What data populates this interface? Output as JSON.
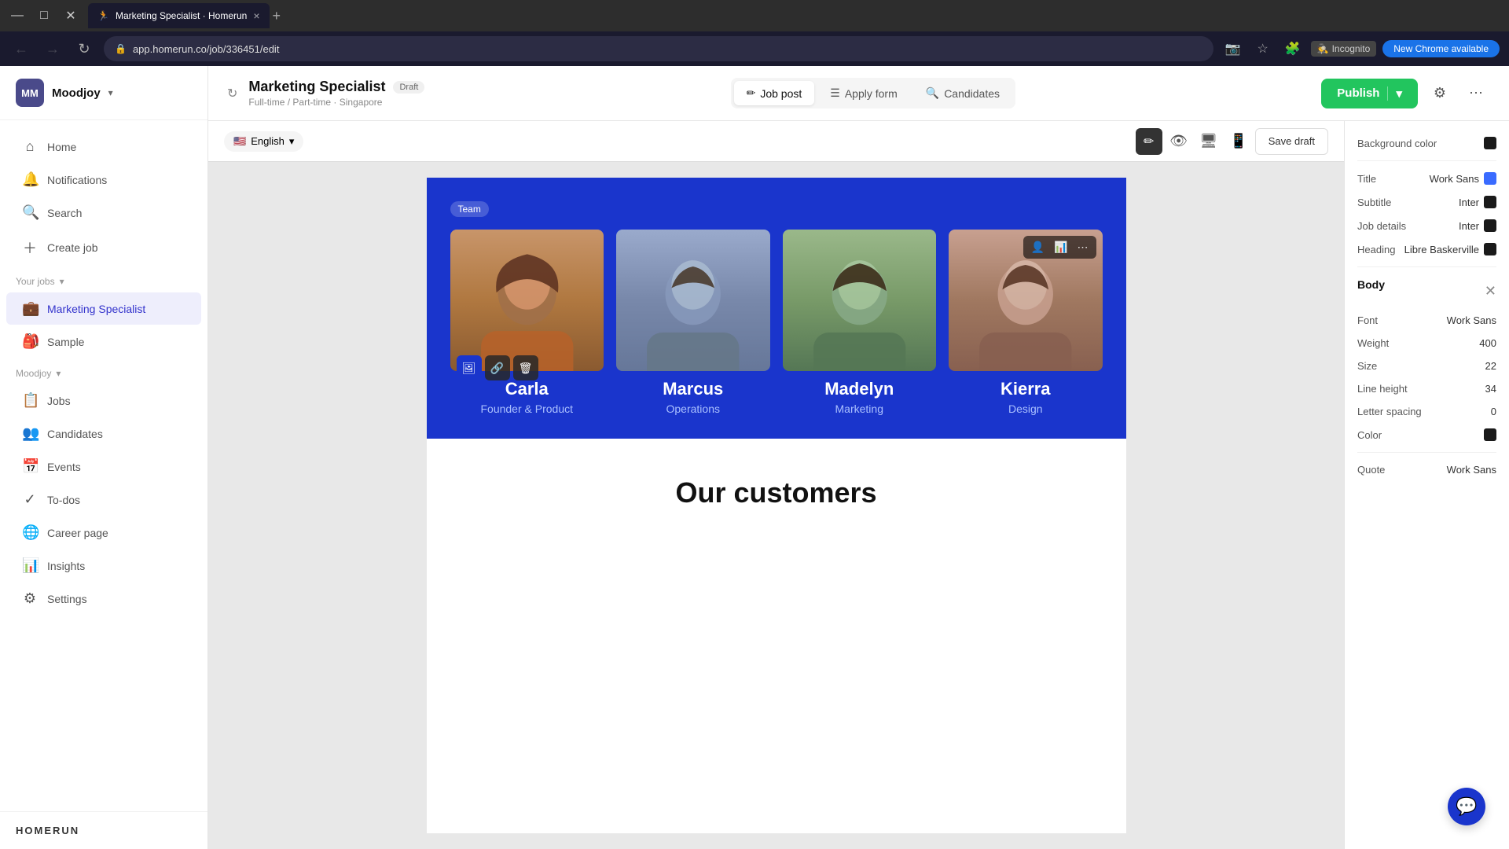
{
  "browser": {
    "tab_title": "Marketing Specialist · Homerun",
    "tab_favicon": "🏃",
    "tab_close": "×",
    "new_tab": "+",
    "url": "app.homerun.co/job/336451/edit",
    "back_btn": "←",
    "forward_btn": "→",
    "refresh_btn": "↻",
    "incognito_label": "Incognito",
    "new_chrome_label": "New Chrome available"
  },
  "sidebar": {
    "company_initials": "MM",
    "company_name": "Moodjoy",
    "nav_items": [
      {
        "label": "Home",
        "icon": "⌂",
        "active": false
      },
      {
        "label": "Notifications",
        "icon": "🔔",
        "active": false
      },
      {
        "label": "Search",
        "icon": "🔍",
        "active": false
      },
      {
        "label": "Create job",
        "icon": "+",
        "active": false
      }
    ],
    "your_jobs_label": "Your jobs",
    "jobs_list": [
      {
        "label": "Marketing Specialist",
        "active": true,
        "icon": "💼"
      },
      {
        "label": "Sample",
        "icon": "🎒"
      }
    ],
    "company_section": "Moodjoy",
    "company_nav": [
      {
        "label": "Jobs",
        "icon": "📋"
      },
      {
        "label": "Candidates",
        "icon": "👥"
      },
      {
        "label": "Events",
        "icon": "📅"
      },
      {
        "label": "To-dos",
        "icon": "✓"
      },
      {
        "label": "Career page",
        "icon": "🌐"
      },
      {
        "label": "Insights",
        "icon": "📊"
      },
      {
        "label": "Settings",
        "icon": "⚙"
      }
    ],
    "homerun_logo": "HOMERUN"
  },
  "header": {
    "job_title": "Marketing Specialist",
    "draft_badge": "Draft",
    "job_meta": "Full-time / Part-time · Singapore",
    "tabs": [
      {
        "label": "Job post",
        "icon": "✏",
        "active": true
      },
      {
        "label": "Apply form",
        "icon": "☰",
        "active": false
      },
      {
        "label": "Candidates",
        "icon": "🔍",
        "active": false
      }
    ],
    "publish_btn": "Publish",
    "settings_icon": "⚙",
    "more_icon": "⋯"
  },
  "canvas_toolbar": {
    "language": "English",
    "flag": "🇺🇸",
    "desktop_icon": "🖥",
    "mobile_icon": "📱",
    "edit_icon": "✏",
    "preview_icon": "👁",
    "save_draft_btn": "Save draft"
  },
  "team_section": {
    "team_tag": "Team",
    "members": [
      {
        "name": "Carla",
        "role": "Founder & Product",
        "img_class": "person-img-carla"
      },
      {
        "name": "Marcus",
        "role": "Operations",
        "img_class": "person-img-marcus"
      },
      {
        "name": "Madelyn",
        "role": "Marketing",
        "img_class": "person-img-madelyn"
      },
      {
        "name": "Kierra",
        "role": "Design",
        "img_class": "person-img-kierra"
      }
    ],
    "card_actions": [
      "🖼",
      "🔗",
      "🗑"
    ],
    "overlay_actions_label": [
      "👤",
      "📊",
      "⋯"
    ]
  },
  "customer_section": {
    "heading": "Our customers"
  },
  "right_panel": {
    "bg_color_label": "Background color",
    "typography_items": [
      {
        "label": "Title",
        "font": "Work Sans",
        "color": "blue"
      },
      {
        "label": "Subtitle",
        "font": "Inter",
        "color": "dark"
      },
      {
        "label": "Job details",
        "font": "Inter",
        "color": "dark"
      },
      {
        "label": "Heading",
        "font": "Libre Baskerville",
        "color": "dark"
      }
    ],
    "body_section_label": "Body",
    "body_props": [
      {
        "label": "Font",
        "value": "Work Sans"
      },
      {
        "label": "Weight",
        "value": "400"
      },
      {
        "label": "Size",
        "value": "22"
      },
      {
        "label": "Line height",
        "value": "34"
      },
      {
        "label": "Letter spacing",
        "value": "0"
      },
      {
        "label": "Color",
        "value": ""
      }
    ],
    "quote_label": "Quote",
    "quote_font": "Work Sans"
  }
}
